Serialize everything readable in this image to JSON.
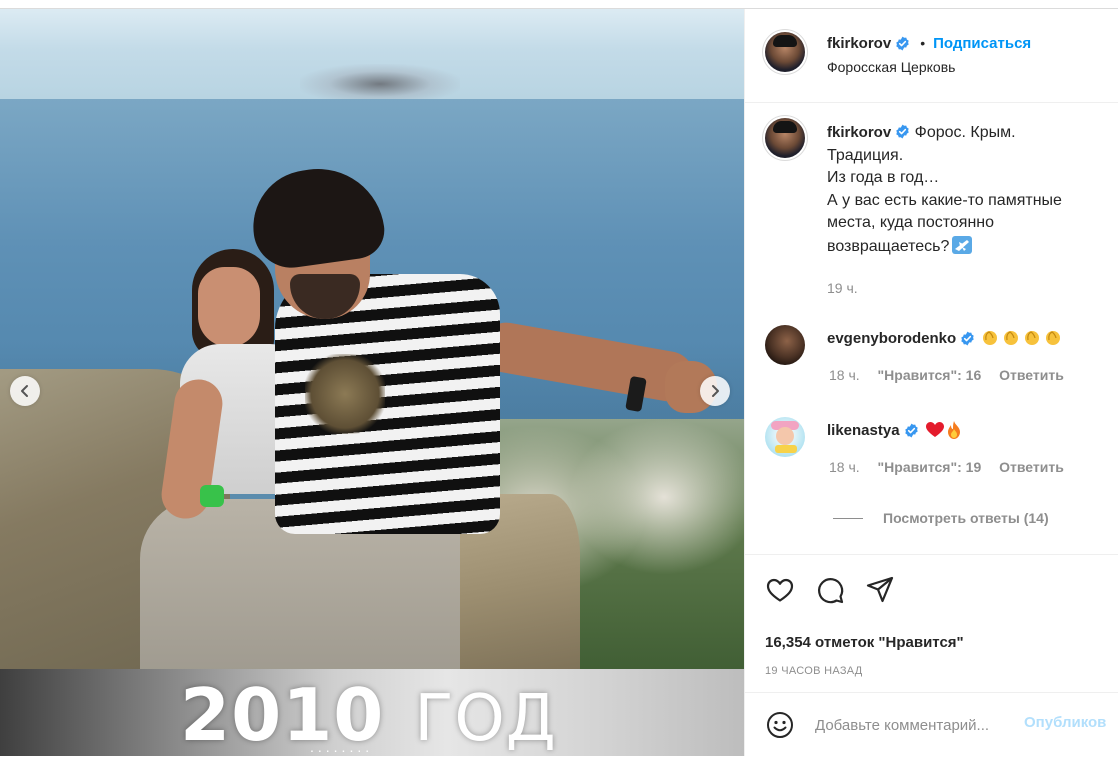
{
  "post": {
    "author": "fkirkorov",
    "follow_label": "Подписаться",
    "dot": "•",
    "location": "Форосская Церковь",
    "media": {
      "overlay_year": "2010",
      "overlay_word": "ГОД",
      "dots": "........"
    },
    "caption": {
      "lines": [
        "Форос. Крым.",
        "Традиция.",
        "Из года в год…",
        "А у вас есть какие-то памятные",
        "места, куда постоянно",
        "возвращаетесь?"
      ],
      "time": "19 ч."
    },
    "comments": [
      {
        "user": "evgenyborodenko",
        "emoji_count": 4,
        "time": "18 ч.",
        "likes": "\"Нравится\": 16",
        "reply": "Ответить"
      },
      {
        "user": "likenastya",
        "emoji": "heart, fire",
        "time": "18 ч.",
        "likes": "\"Нравится\": 19",
        "reply": "Ответить"
      }
    ],
    "view_replies": "Посмотреть ответы (14)",
    "likes_count": "16,354 отметок \"Нравится\"",
    "timestamp": "19 ЧАСОВ НАЗАД",
    "comment_placeholder": "Добавьте комментарий...",
    "post_button": "Опубликов"
  },
  "colors": {
    "accent": "#0095f6",
    "verified": "#3897f0",
    "muted": "#8e8e8e",
    "text": "#262626",
    "post_disabled": "#b2dffc"
  }
}
